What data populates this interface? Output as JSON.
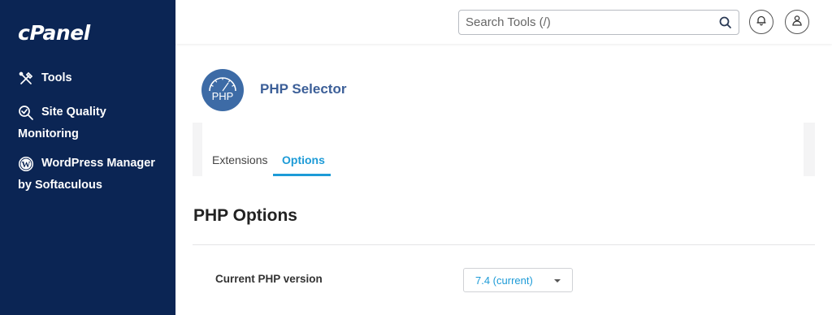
{
  "sidebar": {
    "logo": "cPanel",
    "items": [
      {
        "label": "Tools",
        "icon": "tools-icon"
      },
      {
        "label": "Site Quality",
        "label_cont": "Monitoring",
        "icon": "search-check-icon"
      },
      {
        "label": "WordPress Manager",
        "label_cont": "by Softaculous",
        "icon": "wordpress-icon"
      }
    ]
  },
  "header": {
    "search_placeholder": "Search Tools (/)",
    "icons": [
      "search-icon",
      "bell-icon",
      "user-icon"
    ]
  },
  "app": {
    "logo_text": "PHP",
    "title": "PHP Selector"
  },
  "tabs": [
    {
      "label": "Extensions",
      "active": false
    },
    {
      "label": "Options",
      "active": true
    }
  ],
  "section": {
    "title": "PHP Options",
    "field_label": "Current PHP version",
    "selected_version": "7.4 (current)"
  },
  "colors": {
    "sidebar_bg": "#0b2554",
    "accent": "#1d9bd7",
    "title_blue": "#3c5f98",
    "php_logo_bg": "#3d6ba6"
  }
}
